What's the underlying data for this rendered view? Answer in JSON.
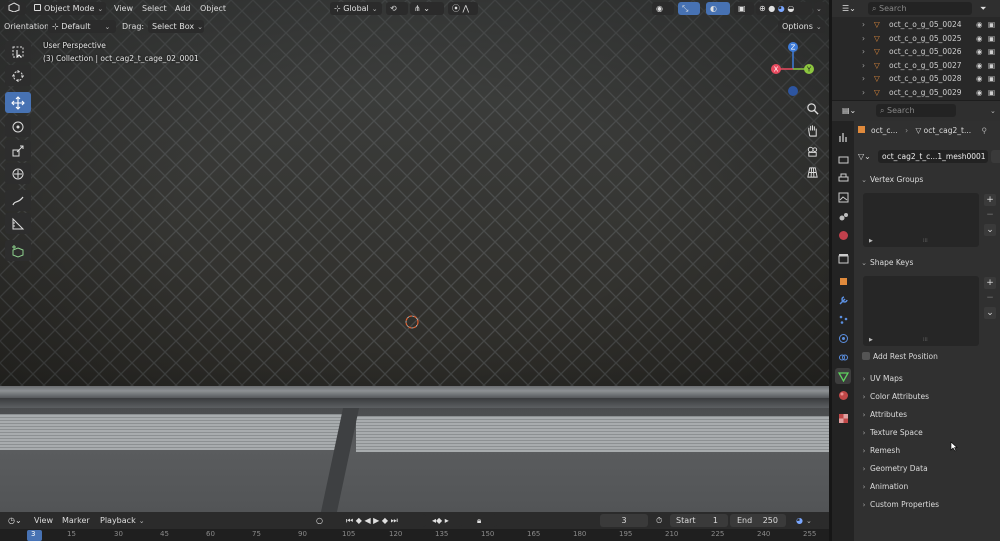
{
  "viewport": {
    "header": {
      "editor_type_icon": "cube-icon",
      "mode_label": "Object Mode",
      "menus": [
        "View",
        "Select",
        "Add",
        "Object"
      ],
      "transform_orientation": "Global",
      "orientation_label": "Orientation:",
      "orientation_value": "Default",
      "drag_label": "Drag:",
      "drag_value": "Select Box",
      "options_label": "Options"
    },
    "overlay": {
      "perspective": "User Perspective",
      "collection": "(3) Collection | oct_cag2_t_cage_02_0001"
    },
    "gizmo": {
      "x": "X",
      "y": "Y",
      "z": "Z"
    }
  },
  "timeline": {
    "menus": [
      "View",
      "Marker",
      "Playback"
    ],
    "current_frame": "3",
    "start_label": "Start",
    "start_value": "1",
    "end_label": "End",
    "end_value": "250",
    "ruler": [
      "3",
      "15",
      "30",
      "45",
      "60",
      "75",
      "90",
      "105",
      "120",
      "135",
      "150",
      "165",
      "180",
      "195",
      "210",
      "225",
      "240",
      "255"
    ]
  },
  "outliner": {
    "search_placeholder": "Search",
    "items": [
      "oct_c_o_g_05_0024",
      "oct_c_o_g_05_0025",
      "oct_c_o_g_05_0026",
      "oct_c_o_g_05_0027",
      "oct_c_o_g_05_0028",
      "oct_c_o_g_05_0029"
    ]
  },
  "properties": {
    "search_placeholder": "Search",
    "breadcrumb_object": "oct_c...",
    "breadcrumb_mesh": "oct_cag2_t...",
    "mesh_name": "oct_cag2_t_c...1_mesh0001",
    "panels": {
      "vertex_groups": "Vertex Groups",
      "shape_keys": "Shape Keys",
      "add_rest_position": "Add Rest Position",
      "uv_maps": "UV Maps",
      "color_attributes": "Color Attributes",
      "attributes": "Attributes",
      "texture_space": "Texture Space",
      "remesh": "Remesh",
      "geometry_data": "Geometry Data",
      "animation": "Animation",
      "custom_properties": "Custom Properties"
    }
  },
  "colors": {
    "accent_blue": "#4772b3",
    "axis_x": "#e84a5f",
    "axis_y": "#8dc63f",
    "axis_z": "#3d7bd8",
    "mesh_icon_orange": "#e08a3c",
    "data_tab_green": "#5fd35f"
  }
}
